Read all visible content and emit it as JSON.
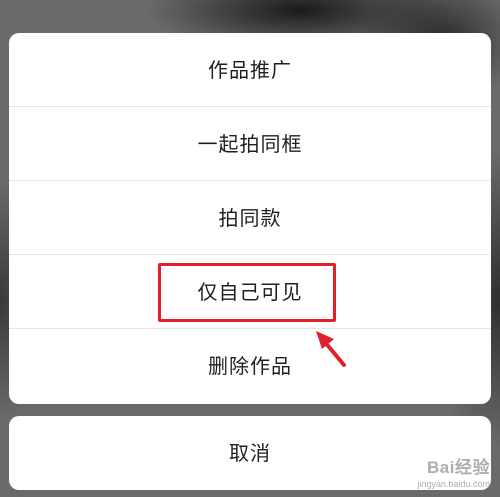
{
  "menu": {
    "items": [
      {
        "label": "作品推广"
      },
      {
        "label": "一起拍同框"
      },
      {
        "label": "拍同款"
      },
      {
        "label": "仅自己可见"
      },
      {
        "label": "删除作品"
      }
    ],
    "cancel_label": "取消"
  },
  "annotation": {
    "highlight_color": "#e0202a",
    "highlighted_item": "仅自己可见"
  },
  "watermark": {
    "brand": "Bai经验",
    "url": "jingyan.baidu.com"
  }
}
